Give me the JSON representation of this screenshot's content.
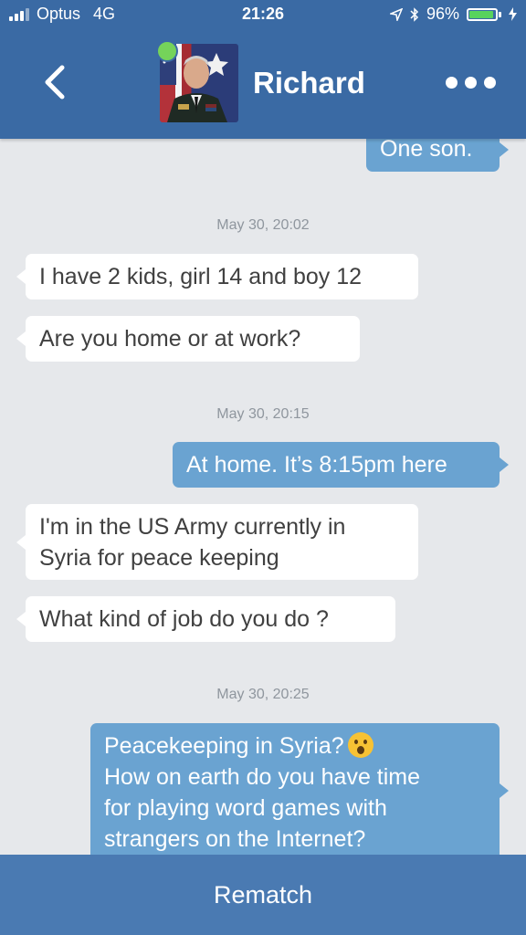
{
  "status_bar": {
    "carrier": "Optus",
    "network": "4G",
    "time": "21:26",
    "battery": "96%"
  },
  "header": {
    "contact_name": "Richard",
    "back_icon": "chevron-left-icon",
    "more_icon": "more-dots-icon"
  },
  "messages": {
    "m0": {
      "text": "One son."
    },
    "ts1": "May 30, 20:02",
    "m1": {
      "text": "I have 2 kids, girl 14 and boy 12"
    },
    "m2": {
      "text": "Are you home or at work?"
    },
    "ts2": "May 30, 20:15",
    "m3": {
      "text": "At home. It’s 8:15pm here"
    },
    "m4": {
      "line1": "I'm in the US Army currently in",
      "line2": "Syria for peace keeping"
    },
    "m5": {
      "text": "What kind of job do you do ?"
    },
    "ts3": "May 30, 20:25",
    "m6": {
      "line1": "Peacekeeping in Syria?",
      "emoji": "hushed-face",
      "line2": "How on earth do you have time",
      "line3": "for playing word games with",
      "line4": "strangers on the Internet?"
    }
  },
  "footer": {
    "rematch_label": "Rematch"
  },
  "colors": {
    "header": "#3a6aa4",
    "outgoing_bubble": "#6aa3d1",
    "incoming_bubble": "#ffffff",
    "background": "#e6e8eb",
    "online": "#75d35a",
    "footer": "#4a7ab2"
  }
}
